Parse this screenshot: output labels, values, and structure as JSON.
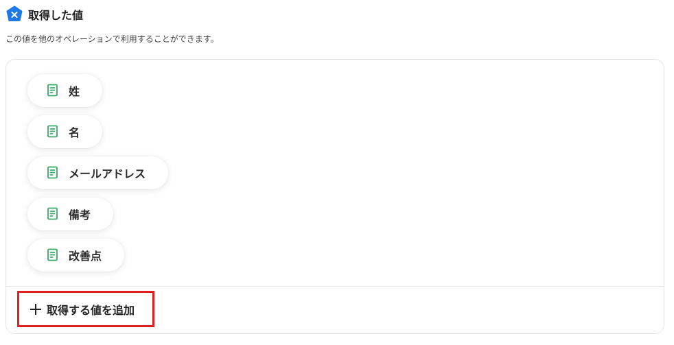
{
  "header": {
    "icon": "brand-shield-x-icon",
    "accent_color": "#1e7be6",
    "title": "取得した値"
  },
  "description": "この値を他のオペレーションで利用することができます。",
  "fields": [
    {
      "label": "姓",
      "icon": "document-field-icon"
    },
    {
      "label": "名",
      "icon": "document-field-icon"
    },
    {
      "label": "メールアドレス",
      "icon": "document-field-icon"
    },
    {
      "label": "備考",
      "icon": "document-field-icon"
    },
    {
      "label": "改善点",
      "icon": "document-field-icon"
    }
  ],
  "field_icon_color": "#3aa866",
  "add_button": {
    "label": "取得する値を追加",
    "icon": "plus-icon",
    "highlight_color": "#e01e1e"
  }
}
